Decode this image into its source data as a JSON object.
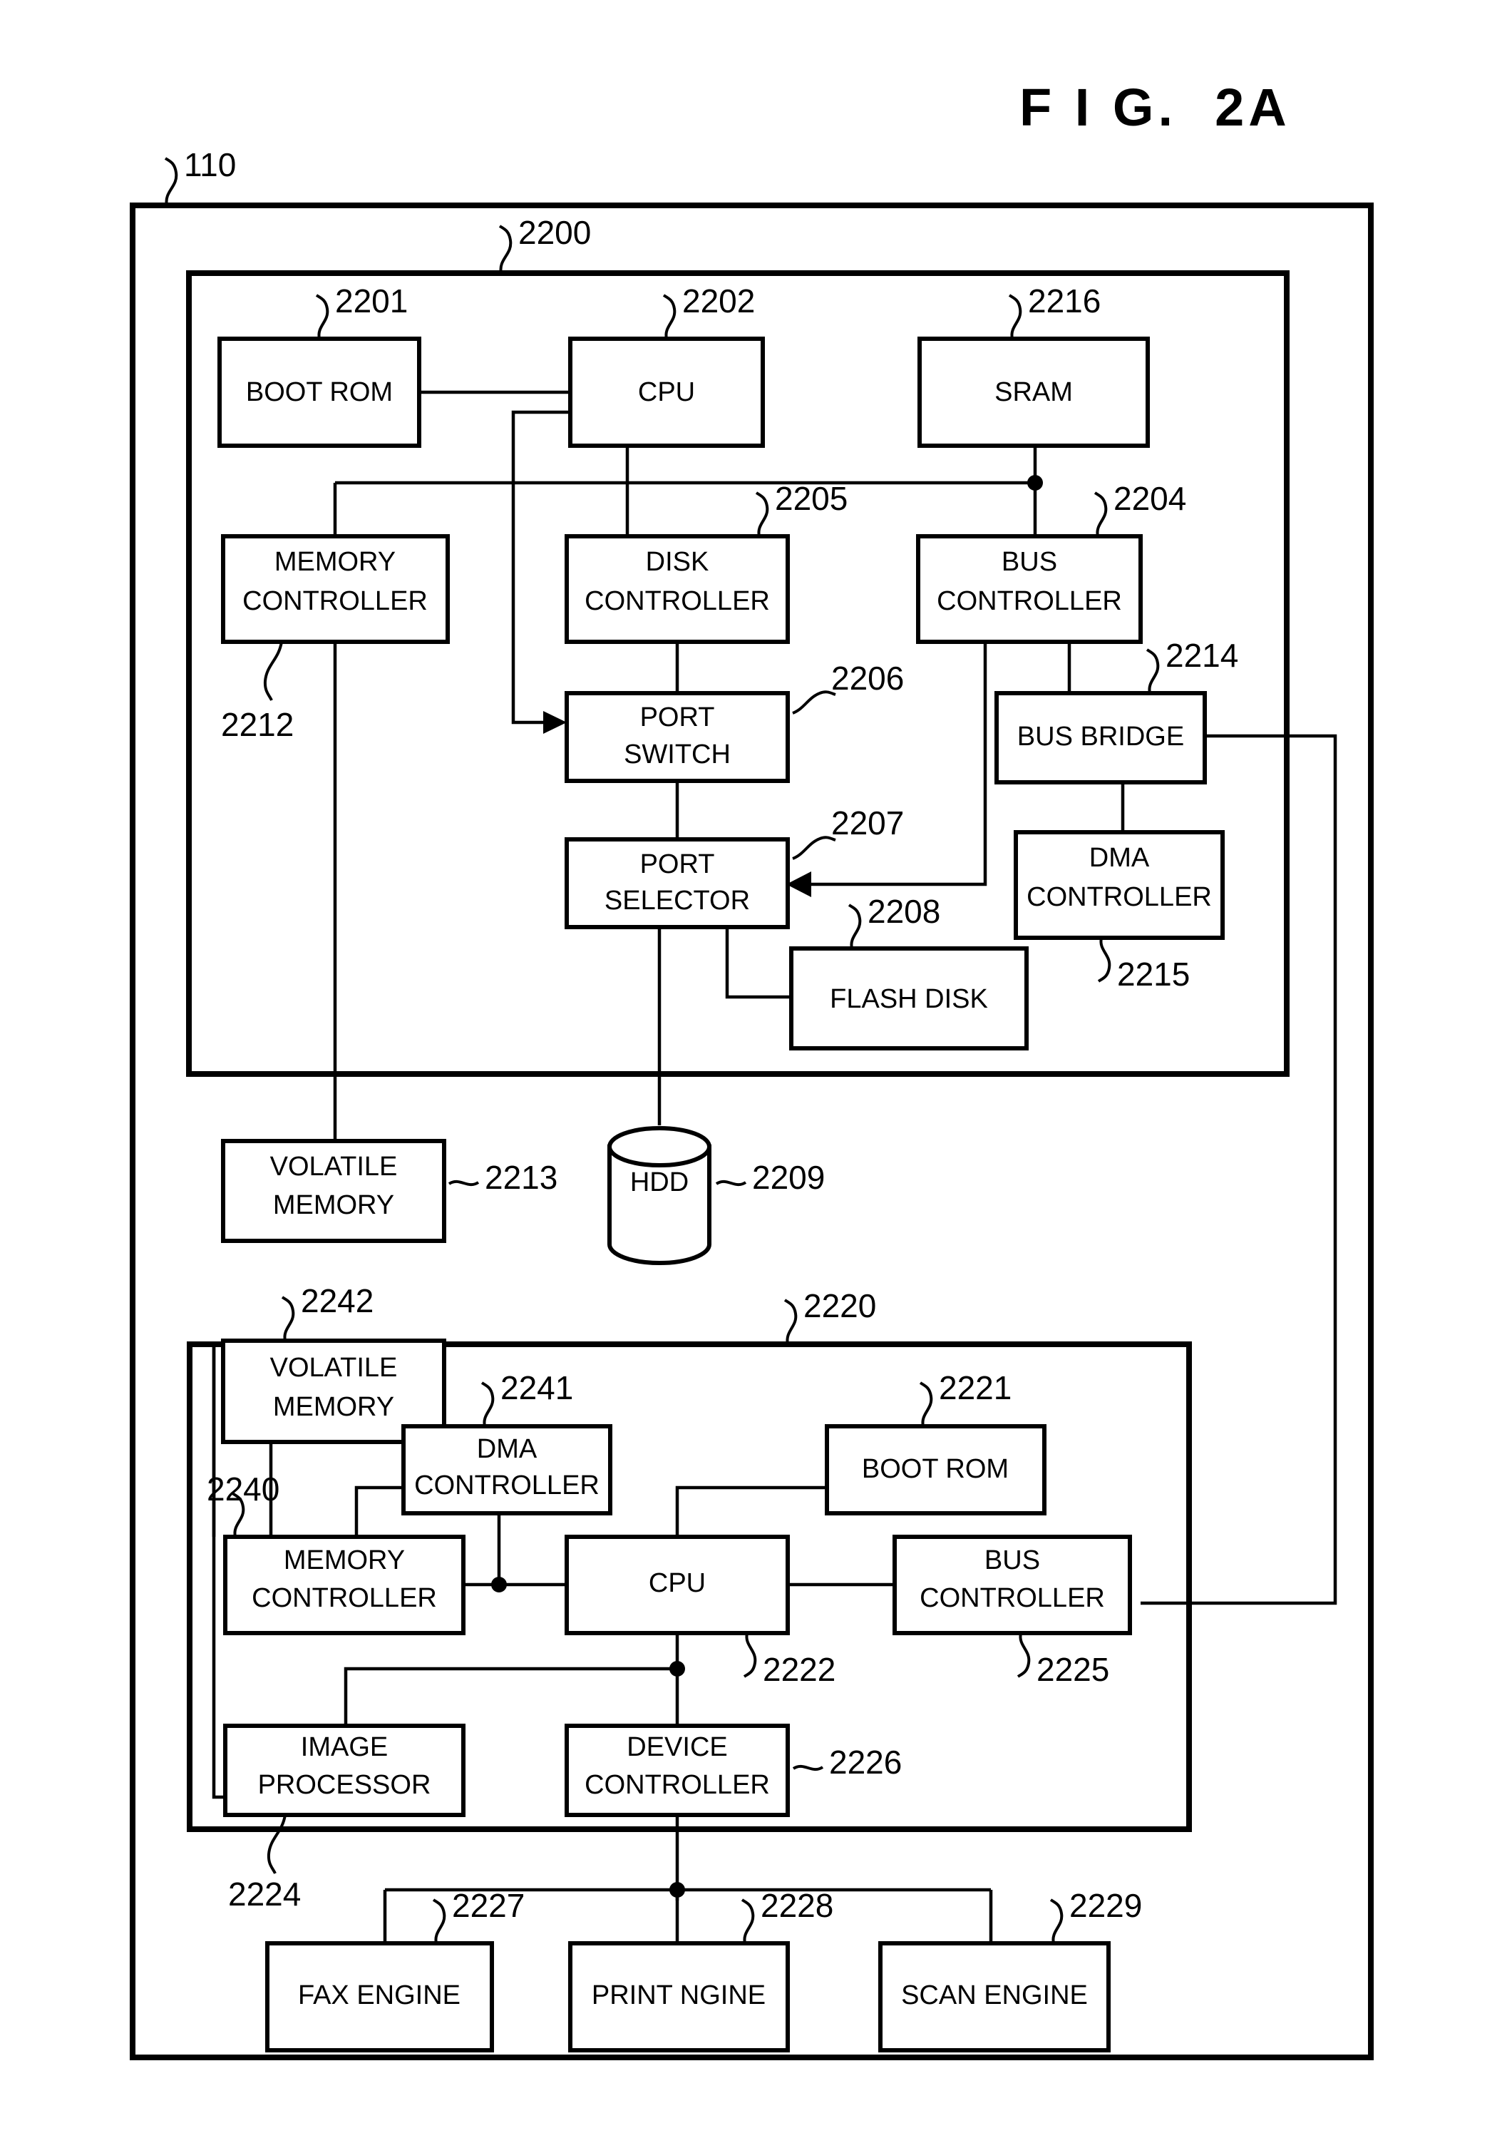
{
  "figure": {
    "title": "F I G.  2A",
    "outer_ref": "110"
  },
  "controller_unit": {
    "ref": "2200",
    "boxes": [
      {
        "id": "boot-rom",
        "label": "BOOT ROM",
        "ref": "2201"
      },
      {
        "id": "cpu",
        "label": "CPU",
        "ref": "2202"
      },
      {
        "id": "sram",
        "label": "SRAM",
        "ref": "2216"
      },
      {
        "id": "memory-controller",
        "label_line1": "MEMORY",
        "label_line2": "CONTROLLER",
        "ref": "2212"
      },
      {
        "id": "disk-controller",
        "label_line1": "DISK",
        "label_line2": "CONTROLLER",
        "ref": "2205"
      },
      {
        "id": "bus-controller",
        "label_line1": "BUS",
        "label_line2": "CONTROLLER",
        "ref": "2204"
      },
      {
        "id": "port-switch",
        "label_line1": "PORT",
        "label_line2": "SWITCH",
        "ref": "2206"
      },
      {
        "id": "bus-bridge",
        "label": "BUS BRIDGE",
        "ref": "2214"
      },
      {
        "id": "port-selector",
        "label_line1": "PORT",
        "label_line2": "SELECTOR",
        "ref": "2207"
      },
      {
        "id": "dma-controller",
        "label_line1": "DMA",
        "label_line2": "CONTROLLER",
        "ref": "2215"
      },
      {
        "id": "flash-disk",
        "label": "FLASH DISK",
        "ref": "2208"
      }
    ]
  },
  "external_storage": [
    {
      "id": "volatile-memory-upper",
      "label_line1": "VOLATILE",
      "label_line2": "MEMORY",
      "ref": "2213"
    },
    {
      "id": "hdd",
      "label": "HDD",
      "ref": "2209"
    }
  ],
  "engine_unit": {
    "ref": "2220",
    "boxes": [
      {
        "id": "volatile-memory-lower",
        "label_line1": "VOLATILE",
        "label_line2": "MEMORY",
        "ref": "2242"
      },
      {
        "id": "dma-controller-2",
        "label_line1": "DMA",
        "label_line2": "CONTROLLER",
        "ref": "2241"
      },
      {
        "id": "boot-rom-2",
        "label": "BOOT ROM",
        "ref": "2221"
      },
      {
        "id": "memory-controller-2",
        "label_line1": "MEMORY",
        "label_line2": "CONTROLLER",
        "ref": "2240"
      },
      {
        "id": "cpu-2",
        "label": "CPU",
        "ref": "2222"
      },
      {
        "id": "bus-controller-2",
        "label_line1": "BUS",
        "label_line2": "CONTROLLER",
        "ref": "2225"
      },
      {
        "id": "image-processor",
        "label_line1": "IMAGE",
        "label_line2": "PROCESSOR",
        "ref": "2224"
      },
      {
        "id": "device-controller",
        "label_line1": "DEVICE",
        "label_line2": "CONTROLLER",
        "ref": "2226"
      }
    ]
  },
  "engines": [
    {
      "id": "fax-engine",
      "label": "FAX ENGINE",
      "ref": "2227"
    },
    {
      "id": "print-engine",
      "label": "PRINT NGINE",
      "ref": "2228"
    },
    {
      "id": "scan-engine",
      "label": "SCAN ENGINE",
      "ref": "2229"
    }
  ],
  "colors": {
    "ink": "#000000",
    "paper": "#ffffff"
  }
}
